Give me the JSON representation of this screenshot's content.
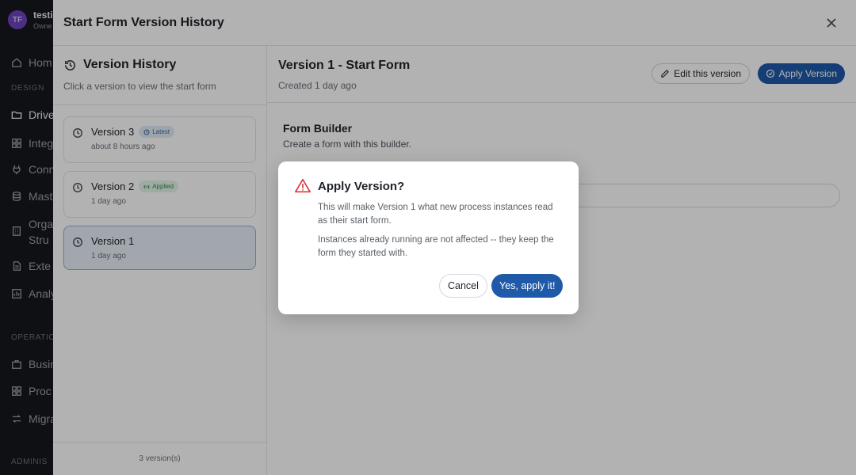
{
  "sidebar": {
    "user": {
      "initials": "TF",
      "name": "testi",
      "role": "Owne"
    },
    "sections": {
      "design": "DESIGN",
      "operations": "OPERATION",
      "admin": "ADMINIS"
    },
    "items": {
      "home": "Hom",
      "drive": "Drive",
      "integrations": "Integ",
      "connections": "Conn",
      "master": "Mast",
      "org_line1": "Orga",
      "org_line2": "Stru",
      "external": "Exte",
      "analytics": "Analy",
      "business": "Busin",
      "processes": "Proc",
      "migrations": "Migra"
    }
  },
  "panel": {
    "title": "Start Form Version History"
  },
  "history": {
    "title": "Version History",
    "subtitle": "Click a version to view the start form",
    "versions": [
      {
        "name": "Version 3",
        "badge": "Latest",
        "time": "about 8 hours ago"
      },
      {
        "name": "Version 2",
        "badge": "Applied",
        "time": "1 day ago"
      },
      {
        "name": "Version 1",
        "badge": "",
        "time": "1 day ago"
      }
    ],
    "footer": "3 version(s)"
  },
  "detail": {
    "title": "Version 1 - Start Form",
    "subtitle": "Created 1 day ago",
    "edit_label": "Edit this version",
    "apply_label": "Apply Version",
    "form_title": "Form Builder",
    "form_subtitle": "Create a form with this builder."
  },
  "dialog": {
    "title": "Apply Version?",
    "body1": "This will make Version 1 what new process instances read as their start form.",
    "body2": "Instances already running are not affected -- they keep the form they started with.",
    "cancel_label": "Cancel",
    "confirm_label": "Yes, apply it!"
  },
  "colors": {
    "accent": "#1e5aa8",
    "warning": "#d9363e",
    "latest_badge": "#3b6aa0",
    "applied_badge": "#2f8a4d"
  }
}
